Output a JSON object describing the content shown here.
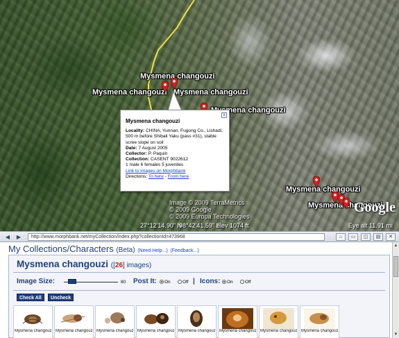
{
  "map": {
    "labels": [
      {
        "text": "Mysmena changouzi"
      },
      {
        "text": "Mysmena changouzi"
      },
      {
        "text": "Mysmena changouzi"
      },
      {
        "text": "Mysmena changouzi"
      },
      {
        "text": "Mysmena changouzi"
      },
      {
        "text": "Mysmena changouzi"
      }
    ],
    "footer": {
      "coords": "27°12'14.90\" N",
      "coords2": "98°42'41.59\" E",
      "elev": "elev 1074 ft",
      "eye_alt": "Eye alt",
      "eye_alt_value": "11.91 mi"
    },
    "copyright": {
      "line1": "Image © 2009 TerraMetrics",
      "line2": "© 2009 Google",
      "line3": "© 2009 Europa Technologies",
      "line4": "Image © 2009 DigitalGlobe"
    },
    "logo": "Google"
  },
  "popup": {
    "title": "Mysmena changouzi",
    "locality_label": "Locality:",
    "locality": "CHINA, Yunnan, Fugong Co., Lishadi, 500 m before Shibali Yaku (pass #31), stable scree slope on soil",
    "date_label": "Date:",
    "date": "7 August 2005",
    "collector_label": "Collector:",
    "collector": "P. Paquin",
    "collection_label": "Collection:",
    "collection": "CASENT 9022612",
    "specimens": "1 male 6 females 5 juveniles",
    "link": "Link to images on Morphbank",
    "directions_label": "Directions:",
    "to_here": "To here",
    "separator": " - ",
    "from_here": "From here",
    "close": "x"
  },
  "browser": {
    "url": "http://www.morphbank.net/myCollection/index.php?collectionId=473968"
  },
  "page": {
    "header": "My Collections/Characters",
    "beta": "(Beta)",
    "need_help": "(Need Help...)",
    "feedback": "(Feedback...)",
    "collection_title": "Mysmena changouzi",
    "count_open": "([",
    "count_value": "26",
    "count_close": "] images)",
    "image_size_label": "Image Size:",
    "image_size_value": "80",
    "image_size_fraction": 0.15,
    "post_it_label": "Post It:",
    "icons_label": "Icons:",
    "on": "On",
    "off": "Off",
    "bar": "|",
    "check_all": "Check All",
    "uncheck": "Uncheck",
    "thumbnails": [
      {
        "caption": "Mysmena changouzi"
      },
      {
        "caption": "Mysmena changouzi"
      },
      {
        "caption": "Mysmena changouzi"
      },
      {
        "caption": "Mysmena changouzi"
      },
      {
        "caption": "Mysmena changouzi"
      },
      {
        "caption": "Mysmena changouzi"
      },
      {
        "caption": "Mysmena changouzi"
      },
      {
        "caption": "Mysmena changouzi"
      }
    ]
  },
  "colors": {
    "brand": "#1f3f7a",
    "count": "#c01b1b",
    "link": "#1a3bd6",
    "pin": "#d42020"
  }
}
